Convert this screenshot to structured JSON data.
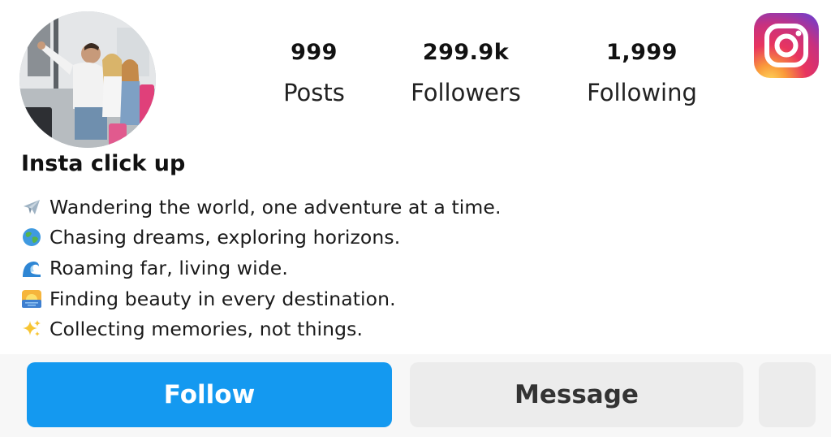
{
  "profile": {
    "username": "Insta click up"
  },
  "stats": {
    "posts": {
      "value": "999",
      "label": "Posts"
    },
    "followers": {
      "value": "299.9k",
      "label": "Followers"
    },
    "following": {
      "value": "1,999",
      "label": "Following"
    }
  },
  "bio": [
    {
      "icon": "airplane-icon",
      "text": "Wandering the world, one adventure at a time."
    },
    {
      "icon": "globe-icon",
      "text": "Chasing dreams, exploring horizons."
    },
    {
      "icon": "wave-icon",
      "text": "Roaming far, living wide."
    },
    {
      "icon": "sunrise-icon",
      "text": "Finding beauty in every destination."
    },
    {
      "icon": "sparkles-icon",
      "text": "Collecting memories, not things."
    }
  ],
  "actions": {
    "follow_label": "Follow",
    "message_label": "Message"
  },
  "colors": {
    "follow_button": "#1499f0",
    "secondary_button": "#ececec",
    "action_bar_bg": "#f7f7f7"
  }
}
